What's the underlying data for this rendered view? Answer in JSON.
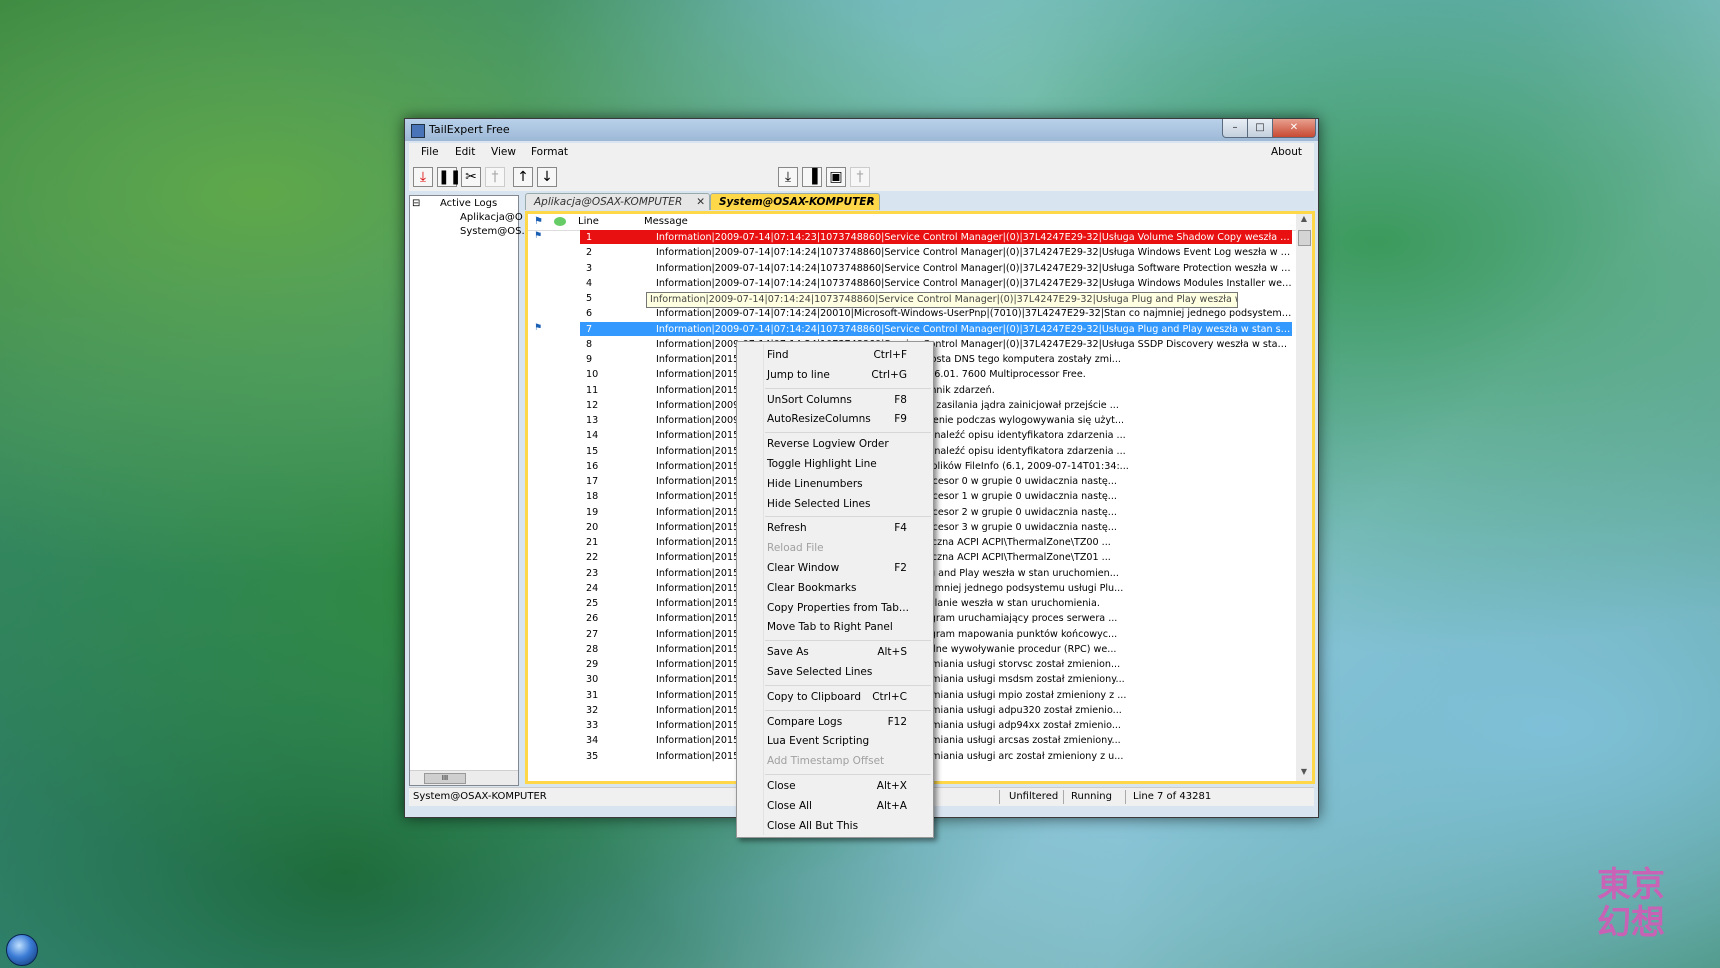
{
  "window": {
    "title": "TailExpert Free",
    "controls": {
      "minimize": "–",
      "maximize": "□",
      "close": "✕"
    }
  },
  "menubar": {
    "file": "File",
    "edit": "Edit",
    "view": "View",
    "format": "Format",
    "about": "About"
  },
  "toolbar": {
    "icons": [
      "⤓",
      "❚❚",
      "✂",
      "†",
      "↑",
      "↓",
      "⤓",
      "▐",
      "▣",
      "†"
    ]
  },
  "tree": {
    "expander": "⊟",
    "root": "Active Logs",
    "items": [
      "Aplikacja@O",
      "System@OS."
    ],
    "scroll_grip": "III"
  },
  "tabs": [
    {
      "label": "Aplikacja@OSAX-KOMPUTER",
      "close": "✕"
    },
    {
      "label": "System@OSAX-KOMPUTER",
      "close": "✕"
    }
  ],
  "grid": {
    "col_line": "Line",
    "col_message": "Message",
    "flag_icon": "⚑",
    "rows": [
      {
        "line": "1",
        "message": "Information|2009-07-14|07:14:23|1073748860|Service Control Manager|(0)|37L4247E29-32|Usługa Volume Shadow Copy weszła w stan sto..."
      },
      {
        "line": "2",
        "message": "Information|2009-07-14|07:14:24|1073748860|Service Control Manager|(0)|37L4247E29-32|Usługa Windows Event Log weszła w stan stop..."
      },
      {
        "line": "3",
        "message": "Information|2009-07-14|07:14:24|1073748860|Service Control Manager|(0)|37L4247E29-32|Usługa Software Protection weszła w stan stopp..."
      },
      {
        "line": "4",
        "message": "Information|2009-07-14|07:14:24|1073748860|Service Control Manager|(0)|37L4247E29-32|Usługa Windows Modules Installer weszła w sta..."
      },
      {
        "line": "5",
        "message": ""
      },
      {
        "line": "6",
        "message": "Information|2009-07-14|07:14:24|20010|Microsoft-Windows-UserPnp|(7010)|37L4247E29-32|Stan co najmniej jednego podsystemu usługi Plu..."
      },
      {
        "line": "7",
        "message": "Information|2009-07-14|07:14:24|1073748860|Service Control Manager|(0)|37L4247E29-32|Usługa Plug and Play weszła w stan stopped."
      },
      {
        "line": "8",
        "message": "Information|2009-07-14|07:14:24|1073748860|Service Control Manager|(0)|37L4247E29-32|Usługa SSDP Discovery weszła w stan stopped."
      },
      {
        "line": "9",
        "message": "Information|2015-         4247E29-32|Nazwa NetBIOS i nazwa hosta DNS tego komputera zostały zmi..."
      },
      {
        "line": "10",
        "message": "Information|2015-         4247E29-32|Microsoft (R) Windows (R) 6.01. 7600  Multiprocessor Free."
      },
      {
        "line": "11",
        "message": "Information|2015-         4247E29-32|Uruchomiono usługę Dziennik zdarzeń."
      },
      {
        "line": "12",
        "message": "Information|2009-         Power|(103)|37L4247E29-32|Menedżer zasilania jądra zainicjował przejście ..."
      },
      {
        "line": "13",
        "message": "Information|2009-         gon|(1102)|37L4247E29-32|Powiadomienie podczas wylogowywania się użyt..."
      },
      {
        "line": "14",
        "message": "Information|2015-         eneral|(0)|37L4247E29-32|Nie można znaleźć opisu identyfikatora zdarzenia ..."
      },
      {
        "line": "15",
        "message": "Information|2015-         eneral|(0)|37L4247E29-32|Nie można znaleźć opisu identyfikatora zdarzenia ..."
      },
      {
        "line": "16",
        "message": "Information|2015-         ager|(0)|37L4247E29-32|Filtr systemu plików FileInfo (6.1, 2009-07-14T01:34:..."
      },
      {
        "line": "17",
        "message": "Information|2015-         rocessor-Power|(4)|37L4247E29-32|Procesor 0 w grupie 0 uwidacznia nastę..."
      },
      {
        "line": "18",
        "message": "Information|2015-         rocessor-Power|(4)|37L4247E29-32|Procesor 1 w grupie 0 uwidacznia nastę..."
      },
      {
        "line": "19",
        "message": "Information|2015-         rocessor-Power|(4)|37L4247E29-32|Procesor 2 w grupie 0 uwidacznia nastę..."
      },
      {
        "line": "20",
        "message": "Information|2015-         rocessor-Power|(4)|37L4247E29-32|Procesor 3 w grupie 0 uwidacznia nastę..."
      },
      {
        "line": "21",
        "message": "Information|2015-         ower|(86)|37L4247E29-32|Strefa termiczna ACPI ACPI\\ThermalZone\\TZ00 ..."
      },
      {
        "line": "22",
        "message": "Information|2015-         ower|(86)|37L4247E29-32|Strefa termiczna ACPI ACPI\\ThermalZone\\TZ01 ..."
      },
      {
        "line": "23",
        "message": "Information|2015-         anager|(0)|37L4247E29-32|Usługa Plug and Play weszła w stan uruchomien..."
      },
      {
        "line": "24",
        "message": "Information|2015-         Pnp|(7010)|37L4247E29-32|Stan co najmniej jednego podsystemu usługi Plu..."
      },
      {
        "line": "25",
        "message": "Information|2015-         anager|(0)|37L4247E29-32|Usługa Zasilanie weszła w stan uruchomienia."
      },
      {
        "line": "26",
        "message": "Information|2015-         anager|(0)|37L4247E29-32|Usługa Program uruchamiający proces serwera ..."
      },
      {
        "line": "27",
        "message": "Information|2015-         anager|(0)|37L4247E29-32|Usługa Program mapowania punktów końcowyc..."
      },
      {
        "line": "28",
        "message": "Information|2015-         anager|(0)|37L4247E29-32|Usługa Zdalne wywoływanie procedur (RPC) we..."
      },
      {
        "line": "29",
        "message": "Information|2015-         anager|(0)|37L4247E29-32|Typ uruchamiania usługi storvsc został zmienion..."
      },
      {
        "line": "30",
        "message": "Information|2015-         anager|(0)|37L4247E29-32|Typ uruchamiania usługi msdsm został zmieniony..."
      },
      {
        "line": "31",
        "message": "Information|2015-         anager|(0)|37L4247E29-32|Typ uruchamiania usługi mpio został zmieniony z ..."
      },
      {
        "line": "32",
        "message": "Information|2015-         anager|(0)|37L4247E29-32|Typ uruchamiania usługi adpu320 został zmienio..."
      },
      {
        "line": "33",
        "message": "Information|2015-         anager|(0)|37L4247E29-32|Typ uruchamiania usługi adp94xx został zmienio..."
      },
      {
        "line": "34",
        "message": "Information|2015-         anager|(0)|37L4247E29-32|Typ uruchamiania usługi arcsas został zmieniony..."
      },
      {
        "line": "35",
        "message": "Information|2015-         anager|(0)|37L4247E29-32|Typ uruchamiania usługi arc został zmieniony z u..."
      }
    ],
    "tooltip": "Information|2009-07-14|07:14:24|1073748860|Service Control Manager|(0)|37L4247E29-32|Usługa Plug and Play weszła w stan stopped."
  },
  "status": {
    "source": "System@OSAX-KOMPUTER",
    "filter": "Unfiltered",
    "state": "Running",
    "position": "Line 7 of 43281"
  },
  "context_menu": {
    "items": [
      {
        "label": "Find",
        "shortcut": "Ctrl+F"
      },
      {
        "label": "Jump to line",
        "shortcut": "Ctrl+G"
      },
      {
        "label": "UnSort Columns",
        "shortcut": "F8"
      },
      {
        "label": "AutoResizeColumns",
        "shortcut": "F9"
      },
      {
        "label": "Reverse Logview Order",
        "shortcut": ""
      },
      {
        "label": "Toggle Highlight Line",
        "shortcut": ""
      },
      {
        "label": "Hide Linenumbers",
        "shortcut": ""
      },
      {
        "label": "Hide Selected Lines",
        "shortcut": ""
      },
      {
        "label": "Refresh",
        "shortcut": "F4"
      },
      {
        "label": "Reload File",
        "shortcut": ""
      },
      {
        "label": "Clear Window",
        "shortcut": "F2"
      },
      {
        "label": "Clear Bookmarks",
        "shortcut": ""
      },
      {
        "label": "Copy Properties from Tab...",
        "shortcut": ""
      },
      {
        "label": "Move Tab to Right Panel",
        "shortcut": ""
      },
      {
        "label": "Save As",
        "shortcut": "Alt+S"
      },
      {
        "label": "Save Selected Lines",
        "shortcut": ""
      },
      {
        "label": "Copy to Clipboard",
        "shortcut": "Ctrl+C"
      },
      {
        "label": "Compare Logs",
        "shortcut": "F12"
      },
      {
        "label": "Lua Event Scripting",
        "shortcut": ""
      },
      {
        "label": "Add Timestamp Offset",
        "shortcut": ""
      },
      {
        "label": "Close",
        "shortcut": "Alt+X"
      },
      {
        "label": "Close All",
        "shortcut": "Alt+A"
      },
      {
        "label": "Close All But This",
        "shortcut": ""
      }
    ]
  },
  "desktop": {
    "start_orb": "",
    "watermark": "東京幻想"
  }
}
